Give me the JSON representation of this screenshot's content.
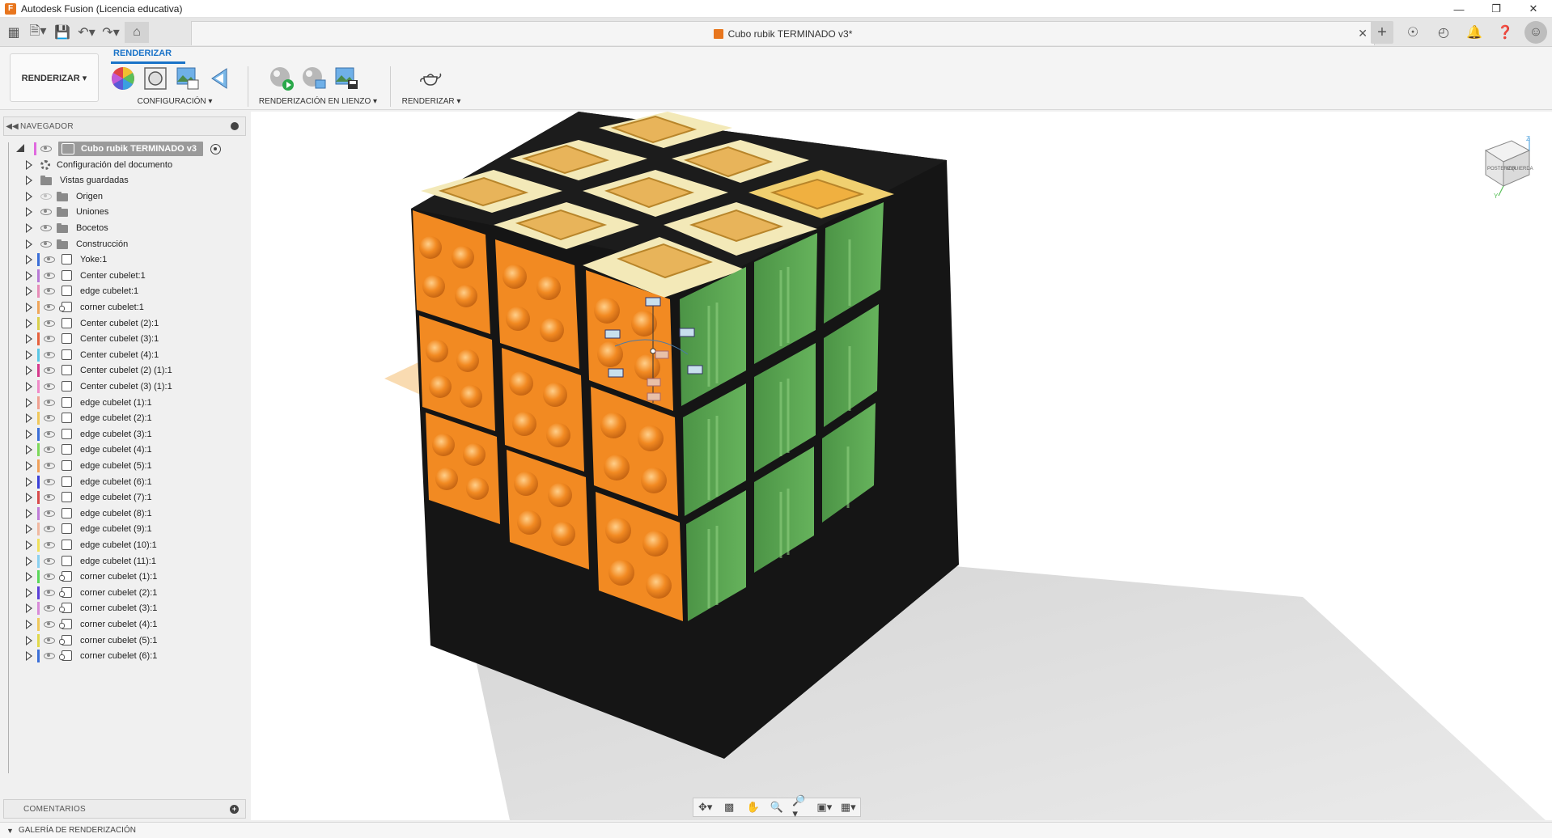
{
  "window": {
    "title": "Autodesk Fusion (Licencia educativa)",
    "app_icon": "F",
    "controls": [
      "minimize",
      "restore",
      "close"
    ]
  },
  "document": {
    "tab_title": "Cubo rubik TERMINADO v3*"
  },
  "toolbar": {
    "workspace_label": "RENDERIZAR ▾",
    "active_tab": "RENDERIZAR",
    "groups": [
      {
        "label": "CONFIGURACIÓN ▾",
        "icons": [
          "appearance-icon",
          "scene-settings-icon",
          "texture-map-icon",
          "decal-icon"
        ]
      },
      {
        "label": "RENDERIZACIÓN EN LIENZO ▾",
        "icons": [
          "in-canvas-render-icon",
          "render-settings-icon",
          "capture-image-icon"
        ]
      },
      {
        "label": "RENDERIZAR ▾",
        "icons": [
          "render-teapot-icon"
        ]
      }
    ]
  },
  "navigator": {
    "title": "NAVEGADOR",
    "root": "Cubo rubik TERMINADO v3",
    "system_items": [
      {
        "label": "Configuración del documento",
        "icon": "gear"
      },
      {
        "label": "Vistas guardadas",
        "icon": "folder"
      },
      {
        "label": "Origen",
        "icon": "folder",
        "hidden": true
      },
      {
        "label": "Uniones",
        "icon": "folder"
      },
      {
        "label": "Bocetos",
        "icon": "folder"
      },
      {
        "label": "Construcción",
        "icon": "folder"
      }
    ],
    "components": [
      {
        "label": "Yoke:1",
        "color": "#3b6fd8",
        "link": false
      },
      {
        "label": "Center cubelet:1",
        "color": "#b879d6",
        "link": false
      },
      {
        "label": "edge cubelet:1",
        "color": "#e78cb8",
        "link": false
      },
      {
        "label": "corner cubelet:1",
        "color": "#f0a65a",
        "link": true
      },
      {
        "label": "Center cubelet (2):1",
        "color": "#d9cf4a",
        "link": false
      },
      {
        "label": "Center cubelet (3):1",
        "color": "#e6603d",
        "link": false
      },
      {
        "label": "Center cubelet (4):1",
        "color": "#5ac7e6",
        "link": false
      },
      {
        "label": "Center cubelet (2) (1):1",
        "color": "#d63a8c",
        "link": false
      },
      {
        "label": "Center cubelet (3) (1):1",
        "color": "#f08ac8",
        "link": false
      },
      {
        "label": "edge cubelet (1):1",
        "color": "#f0a090",
        "link": false
      },
      {
        "label": "edge cubelet (2):1",
        "color": "#f0c85a",
        "link": false
      },
      {
        "label": "edge cubelet (3):1",
        "color": "#3b6fd8",
        "link": false
      },
      {
        "label": "edge cubelet (4):1",
        "color": "#7cd85a",
        "link": false
      },
      {
        "label": "edge cubelet (5):1",
        "color": "#f0a05a",
        "link": false
      },
      {
        "label": "edge cubelet (6):1",
        "color": "#3b3fd8",
        "link": false
      },
      {
        "label": "edge cubelet (7):1",
        "color": "#d84a4a",
        "link": false
      },
      {
        "label": "edge cubelet (8):1",
        "color": "#c07cd8",
        "link": false
      },
      {
        "label": "edge cubelet (9):1",
        "color": "#f0b8a0",
        "link": false
      },
      {
        "label": "edge cubelet (10):1",
        "color": "#f0e05a",
        "link": false
      },
      {
        "label": "edge cubelet (11):1",
        "color": "#8ad0f0",
        "link": false
      },
      {
        "label": "corner cubelet (1):1",
        "color": "#5ad85a",
        "link": true
      },
      {
        "label": "corner cubelet (2):1",
        "color": "#5a3fd8",
        "link": true
      },
      {
        "label": "corner cubelet (3):1",
        "color": "#d88ad8",
        "link": true
      },
      {
        "label": "corner cubelet (4):1",
        "color": "#f0c85a",
        "link": true
      },
      {
        "label": "corner cubelet (5):1",
        "color": "#e0d84a",
        "link": true
      },
      {
        "label": "corner cubelet (6):1",
        "color": "#3b6fd8",
        "link": true
      }
    ]
  },
  "comments": {
    "title": "COMENTARIOS"
  },
  "gallery": {
    "title": "GALERÍA DE RENDERIZACIÓN"
  },
  "viewcube": {
    "faces": [
      "POSTERIOR",
      "IZQUIERDA"
    ],
    "axes": [
      "Z",
      "Y"
    ]
  },
  "colors": {
    "orange_face": "#f28a22",
    "green_face": "#5aa552",
    "top_face": "#f3e9b8",
    "stud": "#e8b45a",
    "cube_body": "#151515",
    "accent": "#1a73c8"
  }
}
